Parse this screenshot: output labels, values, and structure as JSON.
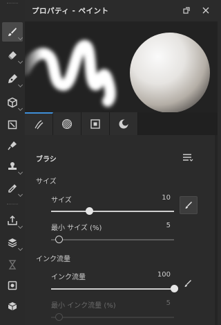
{
  "window": {
    "title": "プロパティ - ペイント"
  },
  "toolstrip": {
    "tools": [
      {
        "name": "brush",
        "icon": "brush-icon",
        "active": true
      },
      {
        "name": "eraser",
        "icon": "eraser-icon"
      },
      {
        "name": "pen",
        "icon": "pen-icon"
      },
      {
        "name": "3d",
        "icon": "cube-icon"
      },
      {
        "name": "projection",
        "icon": "projection-icon"
      },
      {
        "name": "smudge",
        "icon": "smudge-icon"
      },
      {
        "name": "clone",
        "icon": "stamp-icon"
      },
      {
        "name": "color-picker",
        "icon": "eyedropper-icon"
      },
      {
        "name": "export",
        "icon": "export-icon"
      },
      {
        "name": "bake",
        "icon": "bake-icon"
      },
      {
        "name": "history",
        "icon": "hourglass-icon"
      },
      {
        "name": "viewer",
        "icon": "viewer-icon"
      },
      {
        "name": "display",
        "icon": "display-box-icon"
      }
    ]
  },
  "tabs": [
    {
      "name": "brush-tab",
      "icon": "brush-stroke-icon",
      "active": true
    },
    {
      "name": "material-tab",
      "icon": "checker-sphere-icon"
    },
    {
      "name": "mask-tab",
      "icon": "alpha-square-icon"
    },
    {
      "name": "environment-tab",
      "icon": "moon-sphere-icon"
    }
  ],
  "brush": {
    "section_title": "ブラシ",
    "size_group": "サイズ",
    "size_label": "サイズ",
    "size_value": "10",
    "size_fraction": 0.31,
    "min_size_label": "最小 サイズ (%)",
    "min_size_value": "5",
    "min_size_fraction": 0.06,
    "flow_group": "インク流量",
    "flow_label": "インク流量",
    "flow_value": "100",
    "flow_fraction": 1.0,
    "min_flow_label": "最小 インク流量 (%)",
    "min_flow_value": "5",
    "min_flow_fraction": 0.06
  },
  "colors": {
    "accent": "#3f8fd8",
    "background": "#2b2b2b"
  }
}
